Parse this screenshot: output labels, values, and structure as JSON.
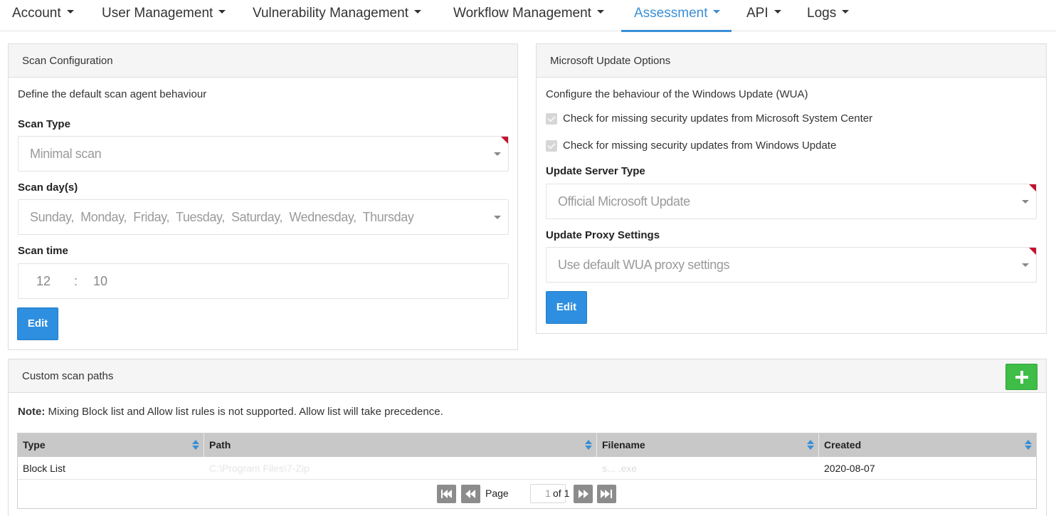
{
  "nav": {
    "items": [
      {
        "label": "Account"
      },
      {
        "label": "User Management"
      },
      {
        "label": "Vulnerability Management"
      },
      {
        "label": "Workflow Management"
      },
      {
        "label": "Assessment",
        "active": true
      },
      {
        "label": "API"
      },
      {
        "label": "Logs"
      }
    ],
    "active_color": "#3a8fd6"
  },
  "scan_config": {
    "title": "Scan Configuration",
    "description": "Define the default scan agent behaviour",
    "scan_type_label": "Scan Type",
    "scan_type_value": "Minimal scan",
    "scan_days_label": "Scan day(s)",
    "scan_days_value": "Sunday,  Monday,  Friday,  Tuesday,  Saturday,  Wednesday,  Thursday",
    "scan_time_label": "Scan time",
    "scan_time_hour": "12",
    "scan_time_sep": ":",
    "scan_time_minute": "10",
    "edit_label": "Edit"
  },
  "ms_update": {
    "title": "Microsoft Update Options",
    "description": "Configure the behaviour of the Windows Update (WUA)",
    "checks": [
      {
        "label": "Check for missing security updates from Microsoft System Center",
        "checked": true,
        "disabled": true
      },
      {
        "label": "Check for missing security updates from Windows Update",
        "checked": true,
        "disabled": true
      }
    ],
    "server_type_label": "Update Server Type",
    "server_type_value": "Official Microsoft Update",
    "proxy_label": "Update Proxy Settings",
    "proxy_value": "Use default WUA proxy settings",
    "edit_label": "Edit"
  },
  "custom_paths": {
    "title": "Custom scan paths",
    "note_bold": "Note:",
    "note_text": " Mixing Block list and Allow list rules is not supported. Allow list will take precedence.",
    "add_icon": "plus-icon",
    "add_color": "#3ebd47",
    "table": {
      "columns": [
        "Type",
        "Path",
        "Filename",
        "Created"
      ],
      "rows": [
        {
          "type": "Block List",
          "path": "C:\\Program Files\\7-Zip",
          "filename": "s...  .exe",
          "created": "2020-08-07"
        }
      ]
    },
    "pager": {
      "page_label": "Page",
      "page_value": "1",
      "of_label": "of 1"
    }
  }
}
